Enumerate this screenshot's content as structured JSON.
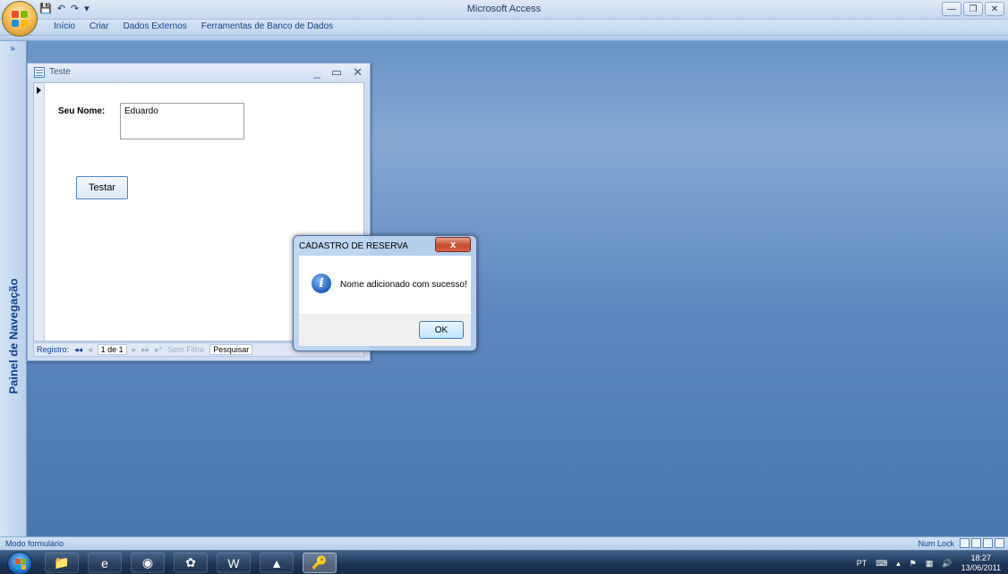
{
  "app": {
    "title": "Microsoft Access",
    "quick_access": {
      "save": "💾",
      "undo": "↶",
      "redo": "↷",
      "customize": "▾"
    },
    "window_controls": {
      "minimize": "—",
      "restore": "❐",
      "close": "✕"
    },
    "colors": {
      "ribbon": "#c6d7ee",
      "workspace": "#5e87bf",
      "accent": "#15428b"
    }
  },
  "ribbon": {
    "tabs": [
      "Início",
      "Criar",
      "Dados Externos",
      "Ferramentas de Banco de Dados"
    ]
  },
  "nav_pane": {
    "toggle": "»",
    "title": "Painel de Navegação"
  },
  "form": {
    "title": "Teste",
    "controls": {
      "minimize": "_",
      "maximize": "▭",
      "close": "✕"
    },
    "name_label": "Seu Nome:",
    "name_value": "Eduardo",
    "test_button": "Testar",
    "navigation": {
      "label": "Registro:",
      "first": "◂◂",
      "prev": "◂",
      "position": "1 de 1",
      "next": "▸",
      "last": "▸▸",
      "new": "▸*",
      "filter": "Sem Filtro",
      "search": "Pesquisar"
    }
  },
  "msgbox": {
    "title": "CADASTRO DE RESERVA",
    "close": "x",
    "icon": "i",
    "message": "Nome adicionado com sucesso!",
    "ok": "OK"
  },
  "status": {
    "mode": "Modo formulário",
    "num_lock": "Num Lock"
  },
  "taskbar": {
    "apps": [
      "📁",
      "e",
      "◉",
      "✿",
      "W",
      "▲",
      "🔑"
    ],
    "language": "PT",
    "tray_icons": [
      "⌨",
      "▴",
      "⚑",
      "▦",
      "🔊"
    ],
    "clock_time": "18:27",
    "clock_date": "13/06/2011"
  }
}
